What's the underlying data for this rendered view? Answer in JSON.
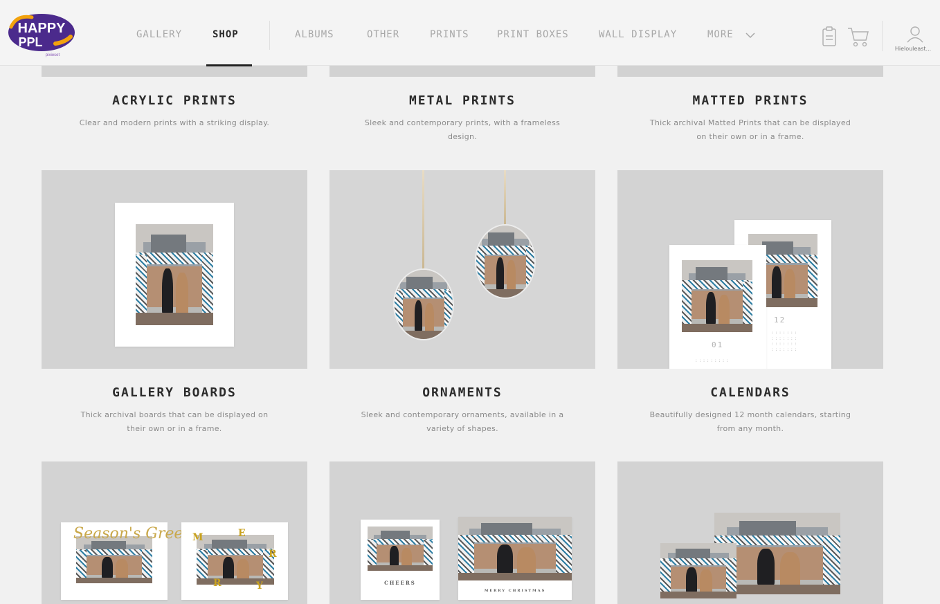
{
  "brand": {
    "logo_text_line1": "HAPPY",
    "logo_text_line2": "PPL",
    "logo_tagline": "pixieset",
    "colors": {
      "purple": "#4b2a8c",
      "orange": "#f2a20d"
    }
  },
  "nav": {
    "items": [
      {
        "label": "GALLERY",
        "active": false
      },
      {
        "label": "SHOP",
        "active": true
      },
      {
        "label": "ALBUMS",
        "active": false
      },
      {
        "label": "OTHER",
        "active": false
      },
      {
        "label": "PRINTS",
        "active": false
      },
      {
        "label": "PRINT BOXES",
        "active": false
      },
      {
        "label": "WALL DISPLAY",
        "active": false
      },
      {
        "label": "MORE",
        "active": false
      }
    ],
    "icons": [
      "favorites-list-icon",
      "cart-icon",
      "user-icon"
    ],
    "user_label": "Hielouleast..."
  },
  "products": [
    {
      "title": "ACRYLIC PRINTS",
      "desc": "Clear and modern prints with a striking display."
    },
    {
      "title": "METAL PRINTS",
      "desc": "Sleek and contemporary prints, with a frameless design."
    },
    {
      "title": "MATTED PRINTS",
      "desc": "Thick archival Matted Prints that can be displayed on their own or in a frame."
    },
    {
      "title": "GALLERY BOARDS",
      "desc": "Thick archival boards that can be displayed on their own or in a frame."
    },
    {
      "title": "ORNAMENTS",
      "desc": "Sleek and contemporary ornaments, available in a variety of shapes."
    },
    {
      "title": "CALENDARS",
      "desc": "Beautifully designed 12 month calendars, starting from any month."
    }
  ],
  "previews": {
    "calendar_left_month": "01",
    "calendar_right_month": "12",
    "card_left_script": "Season's Greetings",
    "card_right_letters": [
      "M",
      "E",
      "R",
      "R",
      "Y"
    ],
    "card_cheers": "CHEERS",
    "card_merry": "MERRY CHRISTMAS"
  }
}
